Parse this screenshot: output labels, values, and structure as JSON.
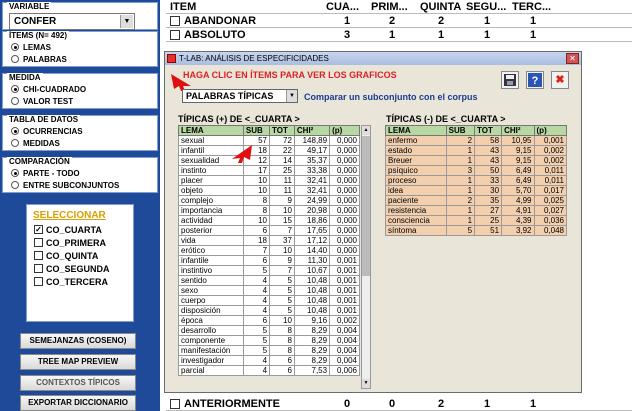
{
  "left": {
    "variable": {
      "title": "VARIABLE",
      "selected": "CONFER"
    },
    "items": {
      "title": "ÍTEMS (N= 492)",
      "options": [
        {
          "label": "LEMAS",
          "on": true
        },
        {
          "label": "PALABRAS",
          "on": false
        }
      ]
    },
    "medida": {
      "title": "MEDIDA",
      "options": [
        {
          "label": "CHI-CUADRADO",
          "on": true
        },
        {
          "label": "VALOR TEST",
          "on": false
        }
      ]
    },
    "tabla": {
      "title": "TABLA DE DATOS",
      "options": [
        {
          "label": "OCURRENCIAS",
          "on": true
        },
        {
          "label": "MEDIDAS",
          "on": false
        }
      ]
    },
    "comparacion": {
      "title": "COMPARACIÓN",
      "options": [
        {
          "label": "PARTE - TODO",
          "on": true
        },
        {
          "label": "ENTRE SUBCONJUNTOS",
          "on": false
        }
      ]
    },
    "seleccionar": {
      "title": "SELECCIONAR",
      "items": [
        {
          "label": "CO_CUARTA",
          "checked": true
        },
        {
          "label": "CO_PRIMERA",
          "checked": false
        },
        {
          "label": "CO_QUINTA",
          "checked": false
        },
        {
          "label": "CO_SEGUNDA",
          "checked": false
        },
        {
          "label": "CO_TERCERA",
          "checked": false
        }
      ]
    },
    "buttons": [
      "SEMEJANZAS (COSENO)",
      "TREE MAP PREVIEW",
      "CONTEXTOS TÍPICOS",
      "EXPORTAR DICCIONARIO"
    ]
  },
  "bg": {
    "headers": [
      "ITEM",
      "CUA...",
      "PRIM...",
      "QUINTA",
      "SEGU...",
      "TERC..."
    ],
    "rows": [
      [
        "ABANDONAR",
        "1",
        "2",
        "2",
        "1",
        "1"
      ],
      [
        "ABSOLUTO",
        "3",
        "1",
        "1",
        "1",
        "1"
      ]
    ],
    "bottom_row": [
      "ANTERIORMENTE",
      "0",
      "0",
      "2",
      "1",
      "1"
    ]
  },
  "dialog": {
    "title": "T-LAB: ANÁLISIS DE ESPECIFICIDADES",
    "hint": "HAGA CLIC EN ÍTEMS PARA VER LOS GRAFICOS",
    "combo": "PALABRAS TÍPICAS",
    "sublink": "Comparar un subconjunto con el corpus",
    "pos_title": "TÍPICAS (+) DE <_CUARTA >",
    "neg_title": "TÍPICAS (-) DE <_CUARTA >",
    "columns": [
      "LEMA",
      "SUB",
      "TOT",
      "CHI²",
      "(p)"
    ],
    "pos_rows": [
      [
        "sexual",
        "57",
        "72",
        "148,89",
        "0,000"
      ],
      [
        "infantil",
        "18",
        "22",
        "49,17",
        "0,000"
      ],
      [
        "sexualidad",
        "12",
        "14",
        "35,37",
        "0,000"
      ],
      [
        "instinto",
        "17",
        "25",
        "33,38",
        "0,000"
      ],
      [
        "placer",
        "10",
        "11",
        "32,41",
        "0,000"
      ],
      [
        "objeto",
        "10",
        "11",
        "32,41",
        "0,000"
      ],
      [
        "complejo",
        "8",
        "9",
        "24,99",
        "0,000"
      ],
      [
        "importancia",
        "8",
        "10",
        "20,98",
        "0,000"
      ],
      [
        "actividad",
        "10",
        "15",
        "18,86",
        "0,000"
      ],
      [
        "posterior",
        "6",
        "7",
        "17,65",
        "0,000"
      ],
      [
        "vida",
        "18",
        "37",
        "17,12",
        "0,000"
      ],
      [
        "erótico",
        "7",
        "10",
        "14,40",
        "0,000"
      ],
      [
        "infantile",
        "6",
        "9",
        "11,30",
        "0,001"
      ],
      [
        "instintivo",
        "5",
        "7",
        "10,67",
        "0,001"
      ],
      [
        "sentido",
        "4",
        "5",
        "10,48",
        "0,001"
      ],
      [
        "sexo",
        "4",
        "5",
        "10,48",
        "0,001"
      ],
      [
        "cuerpo",
        "4",
        "5",
        "10,48",
        "0,001"
      ],
      [
        "disposición",
        "4",
        "5",
        "10,48",
        "0,001"
      ],
      [
        "época",
        "6",
        "10",
        "9,16",
        "0,002"
      ],
      [
        "desarrollo",
        "5",
        "8",
        "8,29",
        "0,004"
      ],
      [
        "componente",
        "5",
        "8",
        "8,29",
        "0,004"
      ],
      [
        "manifestación",
        "5",
        "8",
        "8,29",
        "0,004"
      ],
      [
        "investigador",
        "4",
        "6",
        "8,29",
        "0,004"
      ],
      [
        "parcial",
        "4",
        "6",
        "7,53",
        "0,006"
      ]
    ],
    "neg_rows": [
      [
        "enfermo",
        "2",
        "58",
        "10,95",
        "0,001"
      ],
      [
        "estado",
        "1",
        "43",
        "9,15",
        "0,002"
      ],
      [
        "Breuer",
        "1",
        "43",
        "9,15",
        "0,002"
      ],
      [
        "psíquico",
        "3",
        "50",
        "6,49",
        "0,011"
      ],
      [
        "proceso",
        "1",
        "33",
        "6,49",
        "0,011"
      ],
      [
        "idea",
        "1",
        "30",
        "5,70",
        "0,017"
      ],
      [
        "paciente",
        "2",
        "35",
        "4,99",
        "0,025"
      ],
      [
        "resistencia",
        "1",
        "27",
        "4,91",
        "0,027"
      ],
      [
        "consciencia",
        "1",
        "25",
        "4,39",
        "0,036"
      ],
      [
        "síntoma",
        "5",
        "51",
        "3,92",
        "0,048"
      ]
    ]
  }
}
